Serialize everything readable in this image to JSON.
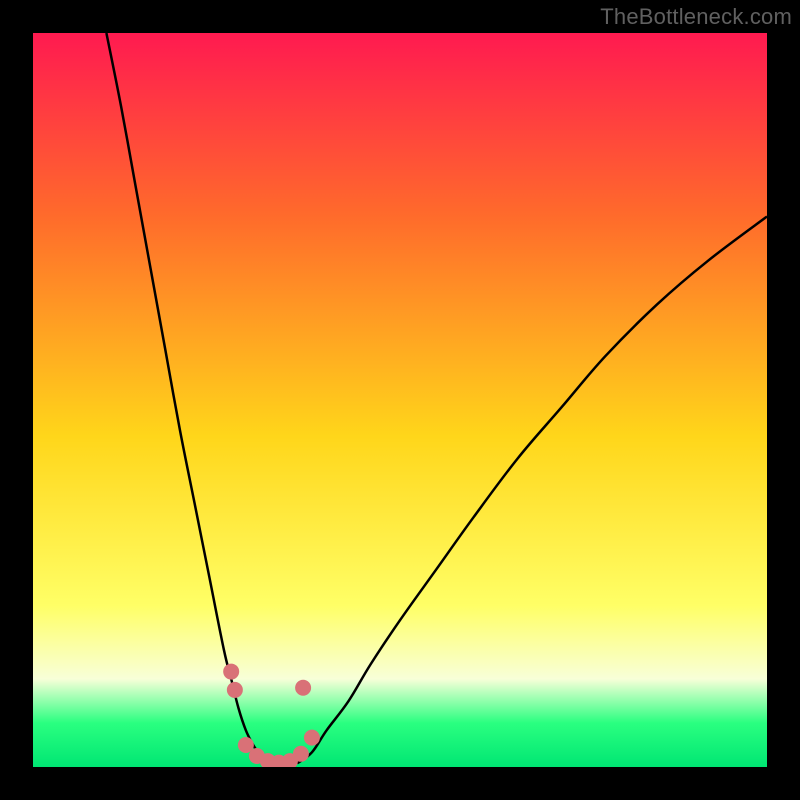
{
  "watermark": "TheBottleneck.com",
  "colors": {
    "frame_bg": "#000000",
    "curve": "#000000",
    "dots": "#d97177",
    "grad_top": "#ff1a50",
    "grad_mid1": "#ff6b2b",
    "grad_mid2": "#ffd61a",
    "grad_low_yellow": "#ffff66",
    "grad_pale": "#f8ffd8",
    "grad_green": "#2aff80",
    "grad_bottom": "#00e673"
  },
  "chart_data": {
    "type": "line",
    "title": "",
    "xlabel": "",
    "ylabel": "",
    "xlim": [
      0,
      100
    ],
    "ylim": [
      0,
      100
    ],
    "series": [
      {
        "name": "left-curve",
        "x": [
          10,
          12,
          14,
          16,
          18,
          20,
          22,
          24,
          26,
          27,
          28,
          29,
          30,
          31,
          32
        ],
        "values": [
          100,
          90,
          79,
          68,
          57,
          46,
          36,
          26,
          16,
          12,
          8,
          5,
          3,
          1.5,
          0.5
        ]
      },
      {
        "name": "right-curve",
        "x": [
          36,
          38,
          40,
          43,
          46,
          50,
          55,
          60,
          66,
          72,
          78,
          85,
          92,
          100
        ],
        "values": [
          0.5,
          2,
          5,
          9,
          14,
          20,
          27,
          34,
          42,
          49,
          56,
          63,
          69,
          75
        ]
      }
    ],
    "dots": [
      {
        "x": 27.0,
        "y": 13.0
      },
      {
        "x": 27.5,
        "y": 10.5
      },
      {
        "x": 29.0,
        "y": 3.0
      },
      {
        "x": 30.5,
        "y": 1.5
      },
      {
        "x": 32.0,
        "y": 0.8
      },
      {
        "x": 33.5,
        "y": 0.6
      },
      {
        "x": 35.0,
        "y": 0.8
      },
      {
        "x": 36.5,
        "y": 1.8
      },
      {
        "x": 38.0,
        "y": 4.0
      },
      {
        "x": 36.8,
        "y": 10.8
      }
    ],
    "gradient_stops_pct_from_top": [
      {
        "offset": 0,
        "color_key": "grad_top"
      },
      {
        "offset": 25,
        "color_key": "grad_mid1"
      },
      {
        "offset": 55,
        "color_key": "grad_mid2"
      },
      {
        "offset": 78,
        "color_key": "grad_low_yellow"
      },
      {
        "offset": 88,
        "color_key": "grad_pale"
      },
      {
        "offset": 94,
        "color_key": "grad_green"
      },
      {
        "offset": 100,
        "color_key": "grad_bottom"
      }
    ]
  }
}
